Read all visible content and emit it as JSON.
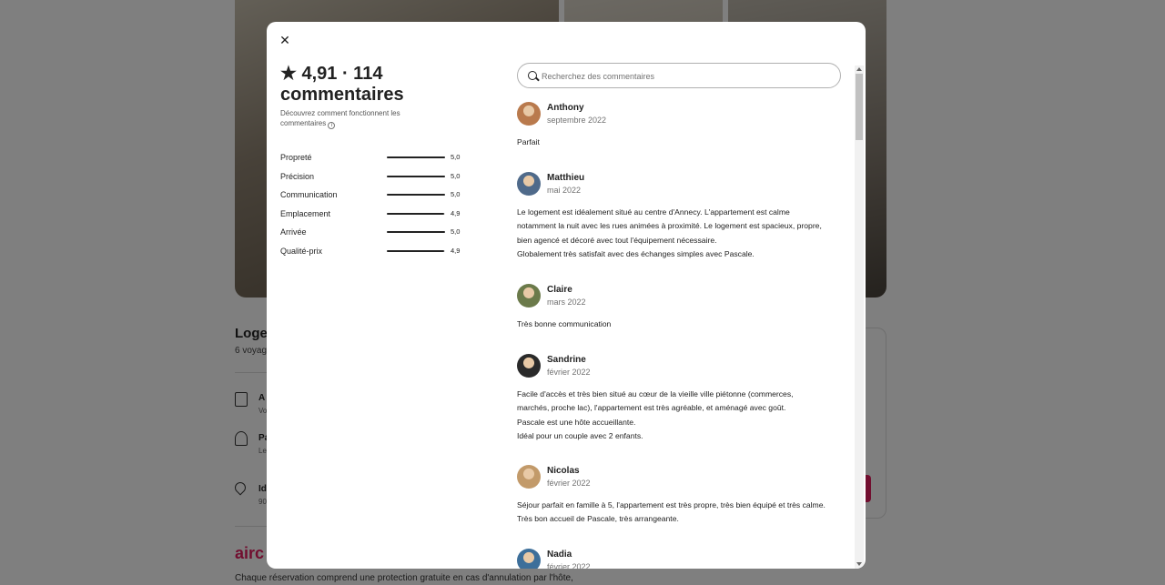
{
  "modal": {
    "close": "✕",
    "rating_line1": "★ 4,91 · 114",
    "rating_line2": "commentaires",
    "how_reviews": "Découvrez comment fonctionnent les commentaires",
    "search_placeholder": "Recherchez des commentaires"
  },
  "categories": [
    {
      "label": "Propreté",
      "value": "5,0",
      "score": 5.0
    },
    {
      "label": "Précision",
      "value": "5,0",
      "score": 5.0
    },
    {
      "label": "Communication",
      "value": "5,0",
      "score": 5.0
    },
    {
      "label": "Emplacement",
      "value": "4,9",
      "score": 4.9
    },
    {
      "label": "Arrivée",
      "value": "5,0",
      "score": 5.0
    },
    {
      "label": "Qualité-prix",
      "value": "4,9",
      "score": 4.9
    }
  ],
  "reviews": [
    {
      "name": "Anthony",
      "date": "septembre 2022",
      "text": "Parfait",
      "avatar_color": "#b97a4d"
    },
    {
      "name": "Matthieu",
      "date": "mai 2022",
      "text": "Le logement est idéalement situé au centre d'Annecy. L'appartement est calme notamment la nuit avec les rues animées à proximité. Le logement est spacieux, propre, bien agencé et décoré avec tout l'équipement nécessaire.\nGlobalement très satisfait avec des échanges simples avec Pascale.",
      "avatar_color": "#4f6a8a"
    },
    {
      "name": "Claire",
      "date": "mars 2022",
      "text": "Très bonne communication",
      "avatar_color": "#6b7a4a"
    },
    {
      "name": "Sandrine",
      "date": "février 2022",
      "text": "Facile d'accès et très bien situé au cœur de la vieille ville piétonne (commerces, marchés, proche lac), l'appartement est très agréable, et aménagé avec goût.\nPascale est une hôte accueillante.\nIdéal pour un couple avec 2 enfants.",
      "avatar_color": "#2a2a2a"
    },
    {
      "name": "Nicolas",
      "date": "février 2022",
      "text": "Séjour parfait en famille à 5, l'appartement est très propre, très bien équipé et très calme. Très bon accueil de Pascale, très arrangeante.",
      "avatar_color": "#c29a6a"
    },
    {
      "name": "Nadia",
      "date": "février 2022",
      "text": "",
      "avatar_color": "#3d6f9a"
    }
  ],
  "background": {
    "title": "Loge",
    "sub": "6 voyag",
    "features": [
      {
        "title": "A",
        "sub": "Vo"
      },
      {
        "title": "Pa",
        "sub": "Le"
      },
      {
        "title": "Id",
        "sub": "90"
      }
    ],
    "logo": "airc",
    "footer": "Chaque réservation comprend une protection gratuite en cas d'annulation par l'hôte,"
  },
  "colors": {
    "accent": "#e31c5f",
    "text": "#222222",
    "muted": "#717171"
  }
}
